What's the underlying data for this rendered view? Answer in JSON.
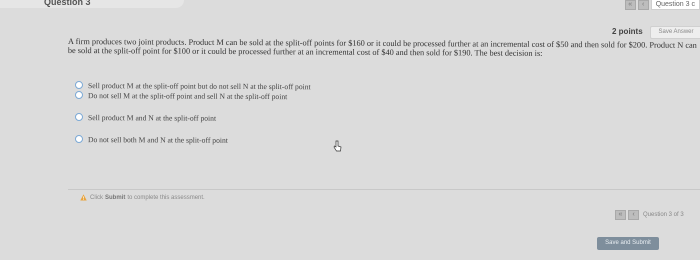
{
  "header": {
    "question_label": "Question 3",
    "question_nav_label": "Question 3 c",
    "prev_icon": "double-left-arrow-icon",
    "next_icon": "left-arrow-icon"
  },
  "question": {
    "points": "2 points",
    "save_answer_label": "Save Answer",
    "text": "A firm produces two joint products. Product M can be sold at the split-off points for $160 or it could be processed further at an incremental cost of $50 and then sold for $200. Product N can be sold at the split-off point for $100 or it could be processed further at an incremental cost of $40 and then sold for $190. The best decision is:",
    "options": [
      "Sell product M at the split-off point but do not sell N at the split-off point",
      "Do not sell M at the split-off point and sell N at the split-off point",
      "Sell product M and N at the split-off point",
      "Do not sell both M and N at the split-off point"
    ]
  },
  "footer": {
    "hint_prefix": "Click",
    "hint_action": "Submit",
    "hint_suffix": "to complete this assessment.",
    "nav_label": "Question 3 of 3",
    "save_submit_label": "Save and Submit"
  },
  "colors": {
    "background": "#dcdcdc",
    "radio_border": "#7ba9d6",
    "submit_button": "#7e8e9c",
    "warning": "#e8a33c"
  }
}
